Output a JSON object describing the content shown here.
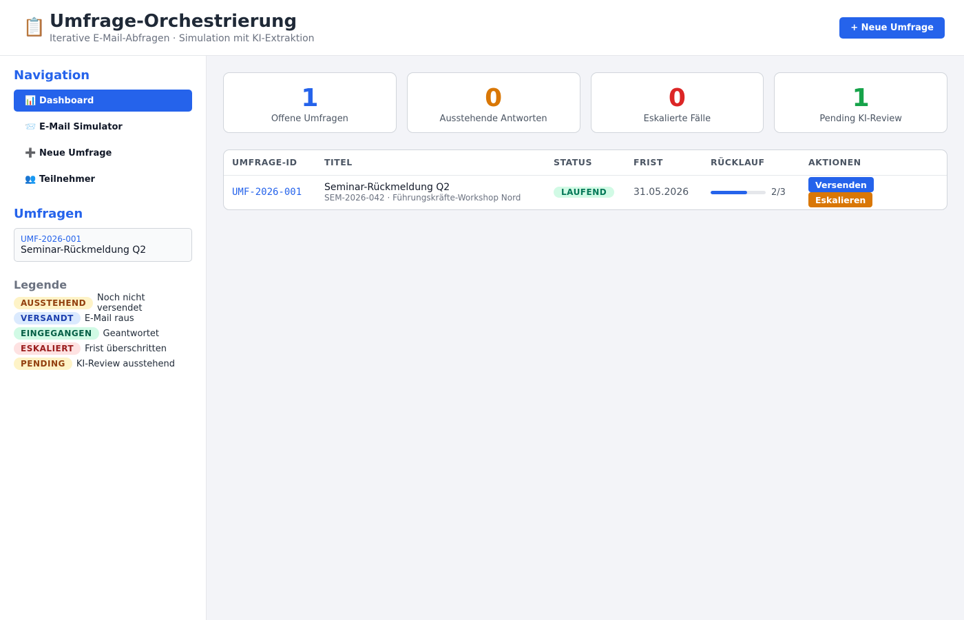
{
  "header": {
    "logo_icon": "📋",
    "title": "Umfrage-Orchestrierung",
    "subtitle": "Iterative E-Mail-Abfragen · Simulation mit KI-Extraktion",
    "new_button": "+ Neue Umfrage"
  },
  "sidebar": {
    "nav_title": "Navigation",
    "nav_items": [
      {
        "icon": "📊",
        "label": "Dashboard",
        "active": true
      },
      {
        "icon": "📨",
        "label": "E-Mail Simulator",
        "active": false
      },
      {
        "icon": "➕",
        "label": "Neue Umfrage",
        "active": false
      },
      {
        "icon": "👥",
        "label": "Teilnehmer",
        "active": false
      }
    ],
    "surveys_title": "Umfragen",
    "surveys": [
      {
        "id": "UMF-2026-001",
        "title": "Seminar-Rückmeldung Q2"
      }
    ],
    "legend_title": "Legende",
    "legend": [
      {
        "badge": "AUSSTEHEND",
        "desc": "Noch nicht versendet",
        "color": "yellow"
      },
      {
        "badge": "VERSANDT",
        "desc": "E-Mail raus",
        "color": "blue"
      },
      {
        "badge": "EINGEGANGEN",
        "desc": "Geantwortet",
        "color": "green"
      },
      {
        "badge": "ESKALIERT",
        "desc": "Frist überschritten",
        "color": "red"
      },
      {
        "badge": "PENDING",
        "desc": "KI-Review ausstehend",
        "color": "yellow"
      }
    ]
  },
  "stats": [
    {
      "value": "1",
      "label": "Offene Umfragen",
      "color": "#2563eb"
    },
    {
      "value": "0",
      "label": "Ausstehende Antworten",
      "color": "#d97706"
    },
    {
      "value": "0",
      "label": "Eskalierte Fälle",
      "color": "#dc2626"
    },
    {
      "value": "1",
      "label": "Pending KI-Review",
      "color": "#16a34a"
    }
  ],
  "table": {
    "columns": [
      "UMFRAGE-ID",
      "TITEL",
      "STATUS",
      "FRIST",
      "RÜCKLAUF",
      "AKTIONEN"
    ],
    "rows": [
      {
        "id": "UMF-2026-001",
        "title": "Seminar-Rückmeldung Q2",
        "subtitle": "SEM-2026-042 · Führungskräfte-Workshop Nord",
        "status": "LAUFEND",
        "deadline": "31.05.2026",
        "return_ratio": "2/3",
        "return_fraction": 0.667,
        "action_send": "Versenden",
        "action_escalate": "Eskalieren"
      }
    ]
  }
}
